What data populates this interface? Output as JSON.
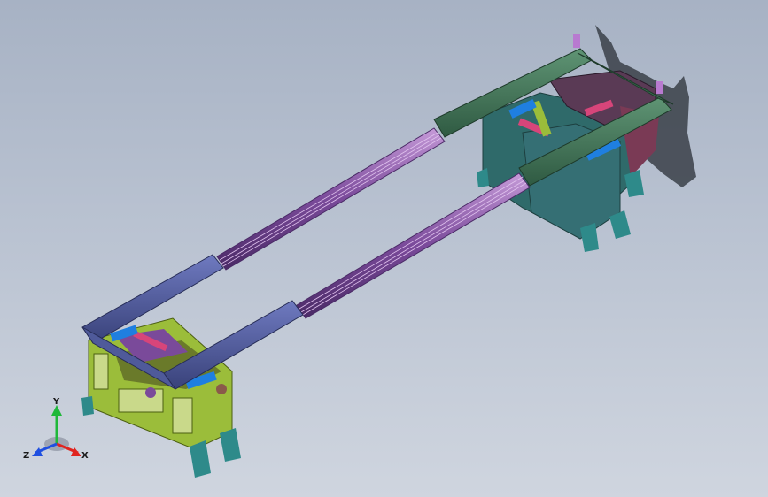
{
  "viewport": {
    "background_top": "#a7b2c4",
    "background_bottom": "#cfd5df"
  },
  "model": {
    "frame_color_left": "#9bbd3a",
    "frame_color_right": "#2f6a6a",
    "beam_color_front": "#4f5a9a",
    "beam_color_back": "#3f7255",
    "rod_color": "#7a4a9a",
    "accent_blue": "#1f7fe0",
    "accent_pink": "#d7457a",
    "foot_color": "#2e8a8a",
    "shadow_color": "#3a3f48"
  },
  "triad": {
    "x_label": "X",
    "y_label": "Y",
    "z_label": "Z",
    "x_color": "#e0241f",
    "y_color": "#1fb83a",
    "z_color": "#1f4fe0",
    "icons": [
      "coordinate-triad-icon"
    ]
  }
}
